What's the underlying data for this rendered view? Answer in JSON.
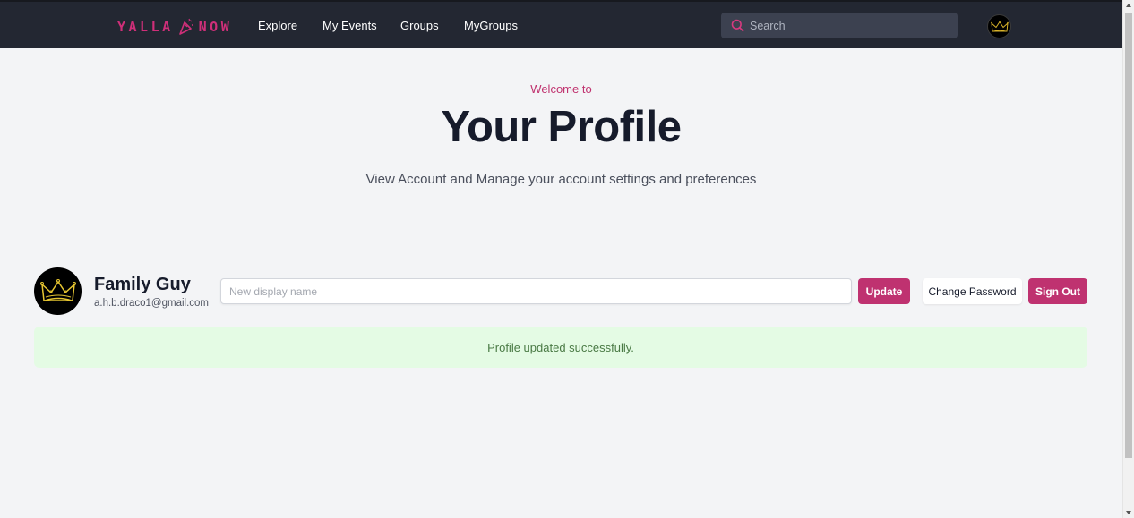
{
  "brand": {
    "left": "YALLA",
    "right": "NOW",
    "color": "#cf2f79",
    "icon": "party-popper-icon"
  },
  "nav": {
    "links": [
      "Explore",
      "My Events",
      "Groups",
      "MyGroups"
    ],
    "search_placeholder": "Search",
    "avatar_icon": "crown-icon"
  },
  "hero": {
    "welcome": "Welcome to",
    "title": "Your Profile",
    "subtitle": "View Account and Manage your account settings and preferences"
  },
  "profile": {
    "name": "Family Guy",
    "email": "a.h.b.draco1@gmail.com",
    "avatar_icon": "crown-icon",
    "display_name_placeholder": "New display name",
    "display_name_value": "",
    "update_label": "Update",
    "change_password_label": "Change Password",
    "sign_out_label": "Sign Out"
  },
  "alert": {
    "message": "Profile updated successfully.",
    "type": "success"
  },
  "colors": {
    "navbar": "#232732",
    "accent": "#bf3270",
    "success_bg": "#e4fbe4",
    "success_text": "#4a7a45"
  }
}
